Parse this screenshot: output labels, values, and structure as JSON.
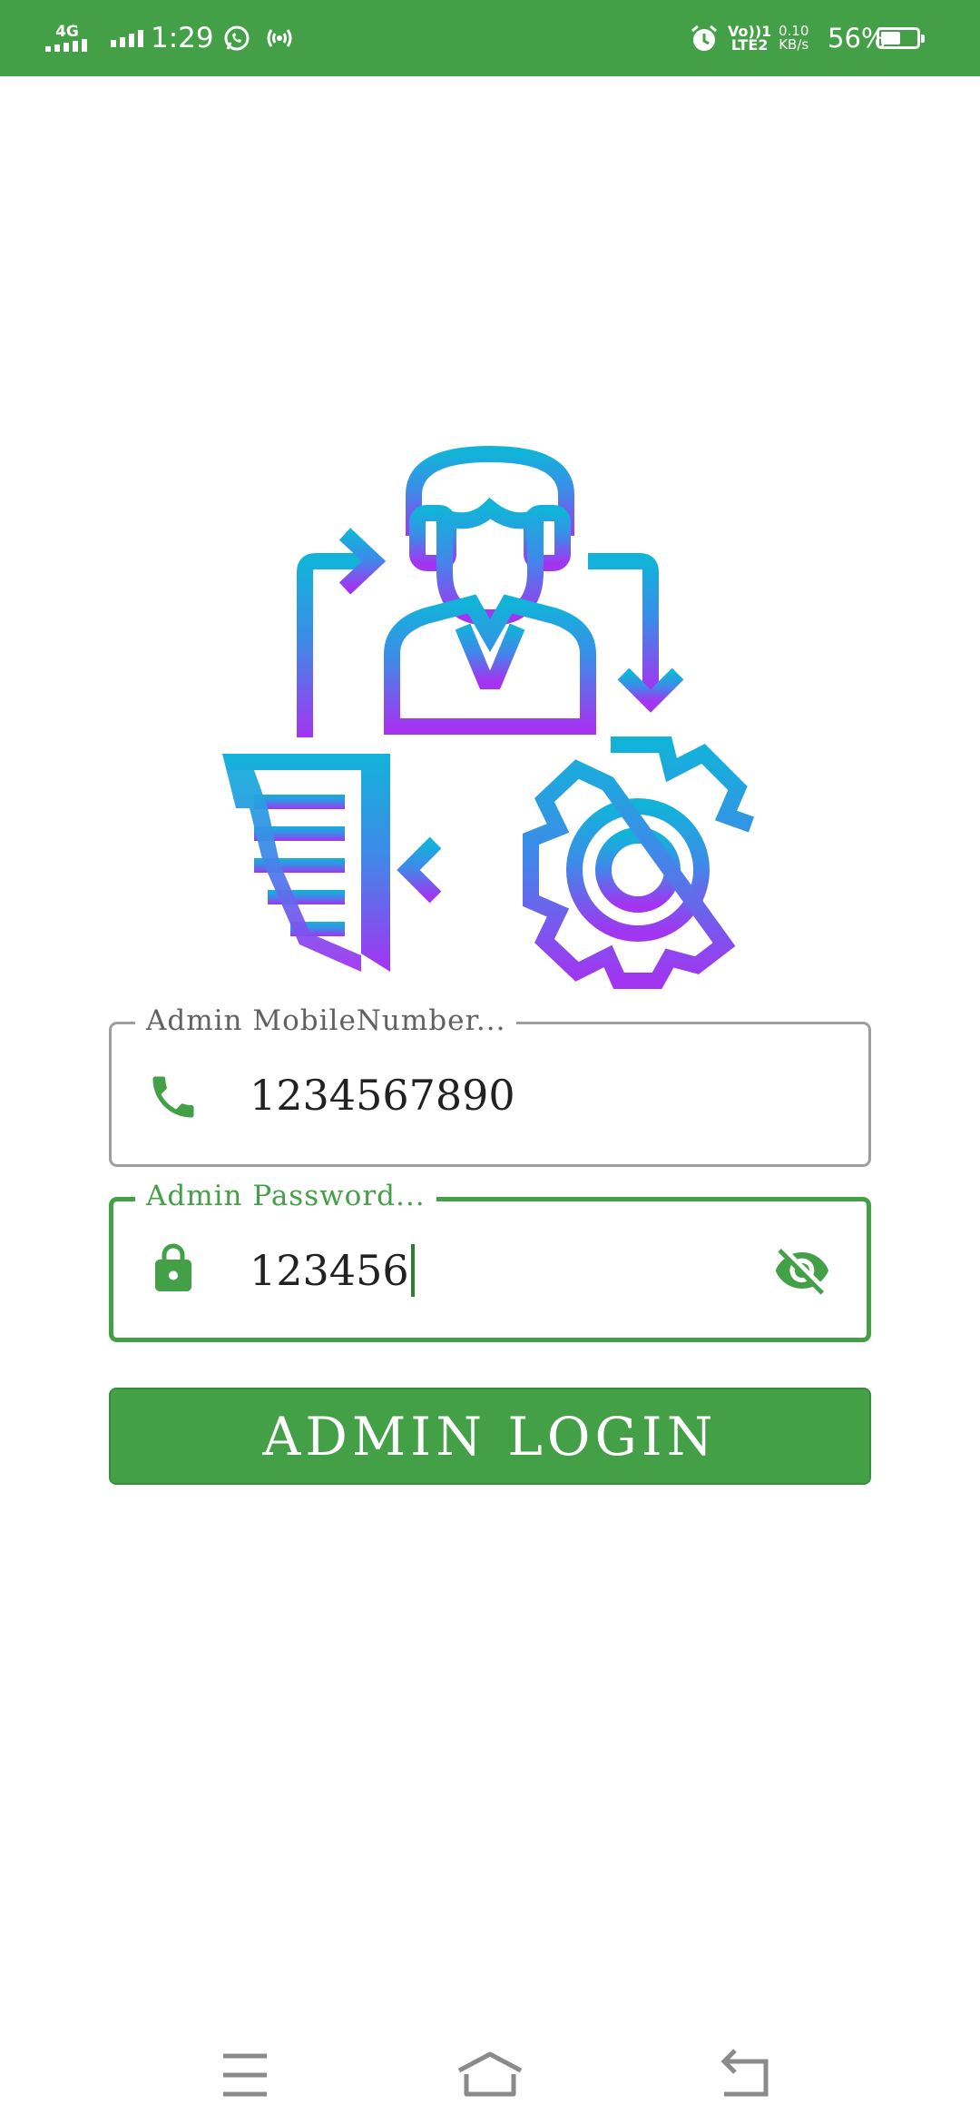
{
  "status_bar": {
    "network": "4G",
    "time": "1:29",
    "volte_line1": "Vo))1",
    "volte_line2": "LTE2",
    "speed_value": "0.10",
    "speed_unit": "KB/s",
    "battery_percent": "56%",
    "battery_level": 0.56,
    "icons": [
      "signal-icon",
      "whatsapp-icon",
      "hotspot-icon",
      "alarm-icon",
      "battery-icon"
    ]
  },
  "logo": {
    "icon": "admin-workflow-icon",
    "gradient": [
      "#12b3d9",
      "#3d8be8",
      "#a334f0"
    ]
  },
  "form": {
    "mobile_label": "Admin MobileNumber...",
    "mobile_value": "1234567890",
    "password_label": "Admin Password...",
    "password_value": "123456",
    "login_button": "ADMIN LOGIN"
  },
  "colors": {
    "primary": "#43a047",
    "border_inactive": "#9e9e9e"
  },
  "nav_bar": {
    "icons": [
      "menu-icon",
      "home-icon",
      "back-icon"
    ]
  }
}
